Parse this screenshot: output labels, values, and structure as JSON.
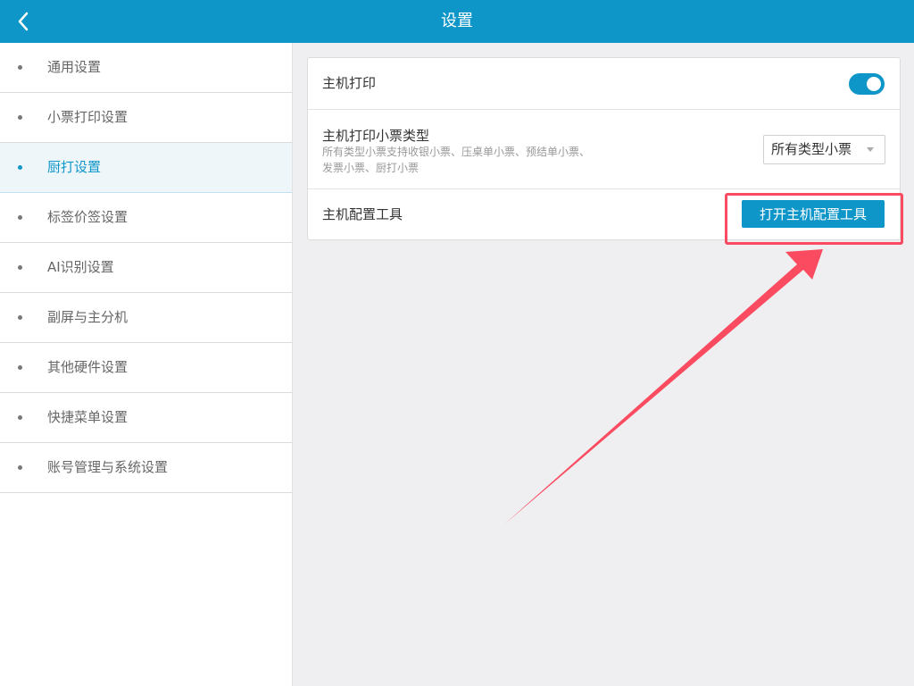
{
  "header": {
    "title": "设置",
    "back_icon": "chevron-left-icon"
  },
  "sidebar": {
    "items": [
      {
        "label": "通用设置",
        "active": false
      },
      {
        "label": "小票打印设置",
        "active": false
      },
      {
        "label": "厨打设置",
        "active": true
      },
      {
        "label": "标签价签设置",
        "active": false
      },
      {
        "label": "AI识别设置",
        "active": false
      },
      {
        "label": "副屏与主分机",
        "active": false
      },
      {
        "label": "其他硬件设置",
        "active": false
      },
      {
        "label": "快捷菜单设置",
        "active": false
      },
      {
        "label": "账号管理与系统设置",
        "active": false
      }
    ]
  },
  "settings": {
    "host_print": {
      "label": "主机打印",
      "enabled": true
    },
    "receipt_type": {
      "label": "主机打印小票类型",
      "description": "所有类型小票支持收银小票、压桌单小票、预结单小票、发票小票、厨打小票",
      "selected": "所有类型小票"
    },
    "config_tool": {
      "label": "主机配置工具",
      "button_label": "打开主机配置工具"
    }
  },
  "annotation": {
    "highlight_color": "#fa4b60",
    "arrow_color": "#fa4b60"
  },
  "colors": {
    "brand": "#0e96c8",
    "background": "#efeff1"
  }
}
